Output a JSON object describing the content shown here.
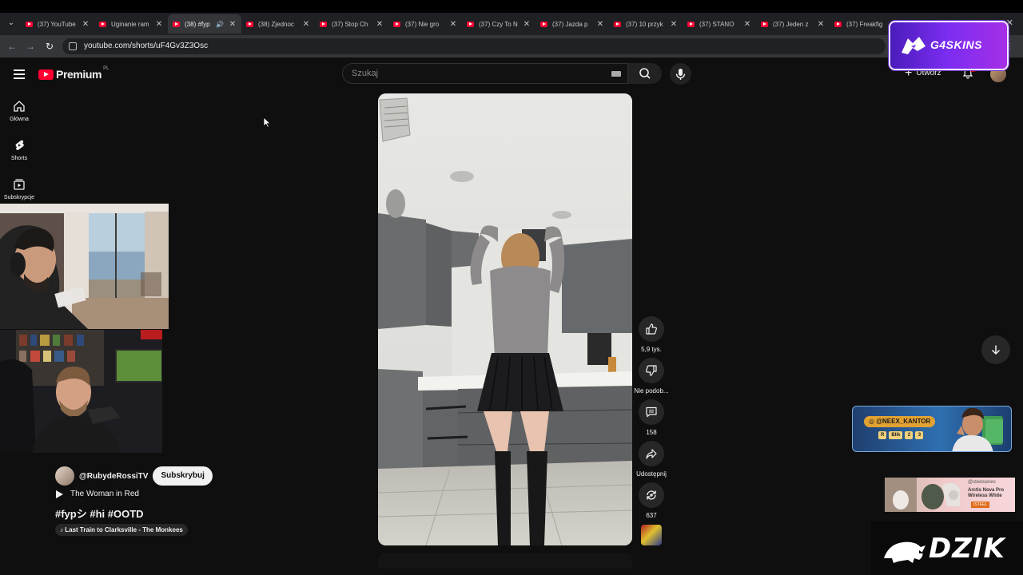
{
  "browser": {
    "tabs": [
      {
        "title": "(37) YouTube"
      },
      {
        "title": "Uginanie ram"
      },
      {
        "title": "(38) #fyp",
        "active": true,
        "audio": true
      },
      {
        "title": "(38) Zjednoc"
      },
      {
        "title": "(37) Stop Ch"
      },
      {
        "title": "(37) Nie gro"
      },
      {
        "title": "(37) Czy To N"
      },
      {
        "title": "(37) Jazda p"
      },
      {
        "title": "(37) 10 przyk"
      },
      {
        "title": "(37) STANO"
      },
      {
        "title": "(37) Jeden z"
      },
      {
        "title": "(37) Freakfig"
      }
    ],
    "url": "youtube.com/shorts/uF4Gv3Z3Osc"
  },
  "header": {
    "logo_text": "Premium",
    "country_code": "PL",
    "search_placeholder": "Szukaj",
    "create_label": "Utwórz"
  },
  "sidebar": {
    "items": [
      {
        "label": "Główna",
        "icon": "home-icon"
      },
      {
        "label": "Shorts",
        "icon": "shorts-icon"
      },
      {
        "label": "Subskrypcje",
        "icon": "subscriptions-icon"
      }
    ]
  },
  "short": {
    "channel": "@RubydeRossiTV",
    "subscribe_label": "Subskrybuj",
    "sound_title": "The Woman in Red",
    "hashtags": "#fypシ #hi #OOTD",
    "music": "Last Train to Clarksville - The Monkees"
  },
  "actions": {
    "likes": "5,9 tys.",
    "dislike_label": "Nie podob...",
    "comments": "158",
    "share_label": "Udostępnij",
    "remix_count": "637"
  },
  "overlays": {
    "sponsor_badge": "G4SKINS",
    "kantor_handle": "@NEEX_KANTOR",
    "kantor_codes": [
      "R",
      "Blik",
      "2",
      "3"
    ],
    "steel_brand": "@steelseries",
    "steel_product": "Arctis Nova Pro Wireless White",
    "steel_button": "ISTEEL",
    "watermark": "DZIK"
  },
  "colors": {
    "yt_red": "#ff0033",
    "background": "#0f0f0f",
    "sponsor_purple": "#7c2df1"
  }
}
